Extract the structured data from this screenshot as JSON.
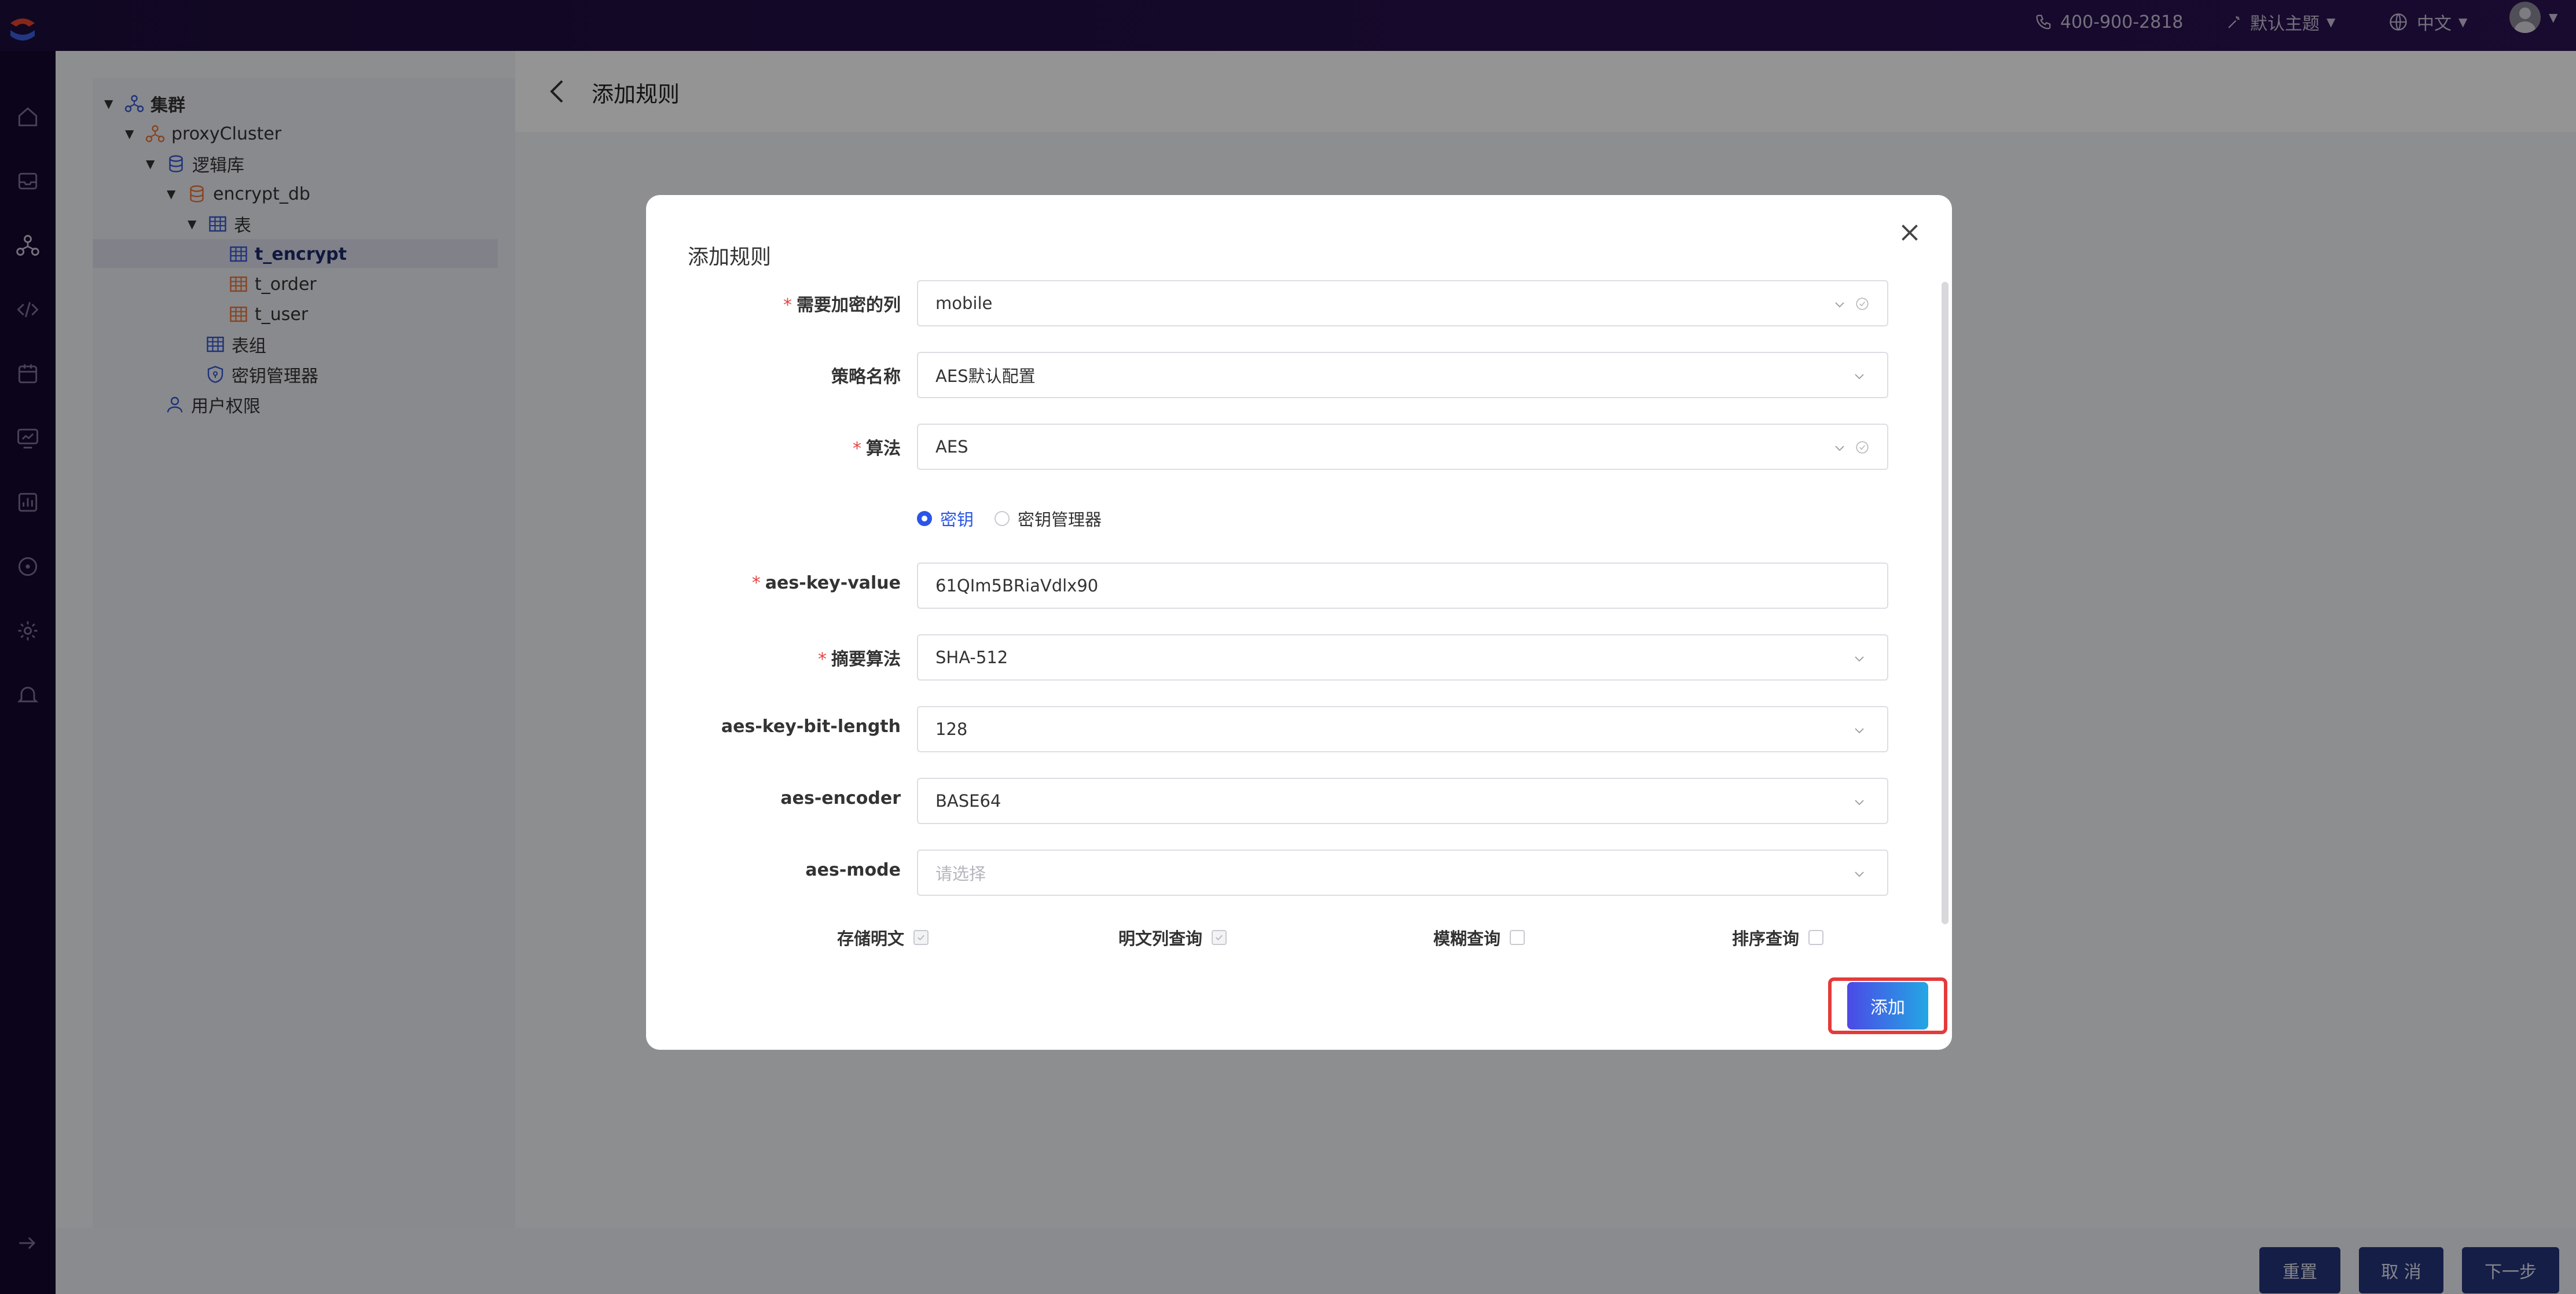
{
  "topbar": {
    "phone": "400-900-2818",
    "theme": "默认主题",
    "language": "中文"
  },
  "tree": {
    "root": "集群",
    "cluster": "proxyCluster",
    "logic_db": "逻辑库",
    "db": "encrypt_db",
    "tables_group": "表",
    "tables": [
      "t_encrypt",
      "t_order",
      "t_user"
    ],
    "table_group": "表组",
    "key_manager": "密钥管理器",
    "user_perm": "用户权限"
  },
  "page": {
    "title": "添加规则"
  },
  "footer": {
    "reset": "重置",
    "cancel": "取 消",
    "next": "下一步"
  },
  "modal": {
    "title": "添加规则",
    "fields": {
      "encrypt_column": {
        "label": "需要加密的列",
        "value": "mobile"
      },
      "policy_name": {
        "label": "策略名称",
        "value": "AES默认配置"
      },
      "algorithm": {
        "label": "算法",
        "value": "AES"
      },
      "aes_key_value": {
        "label": "aes-key-value",
        "value": "61QIm5BRiaVdlx90"
      },
      "digest": {
        "label": "摘要算法",
        "value": "SHA-512"
      },
      "key_bit_length": {
        "label": "aes-key-bit-length",
        "value": "128"
      },
      "encoder": {
        "label": "aes-encoder",
        "value": "BASE64"
      },
      "mode": {
        "label": "aes-mode",
        "placeholder": "请选择"
      }
    },
    "radio": {
      "key": "密钥",
      "key_manager": "密钥管理器",
      "selected": "密钥"
    },
    "checkboxes": {
      "store_plain": {
        "label": "存储明文",
        "checked": true
      },
      "plain_query": {
        "label": "明文列查询",
        "checked": true
      },
      "fuzzy_query": {
        "label": "模糊查询",
        "checked": false
      },
      "order_query": {
        "label": "排序查询",
        "checked": false
      }
    },
    "add_label": "添加"
  },
  "colors": {
    "accent": "#2b55e6",
    "danger": "#e53a3a",
    "topbar": "#1d0d3c"
  }
}
